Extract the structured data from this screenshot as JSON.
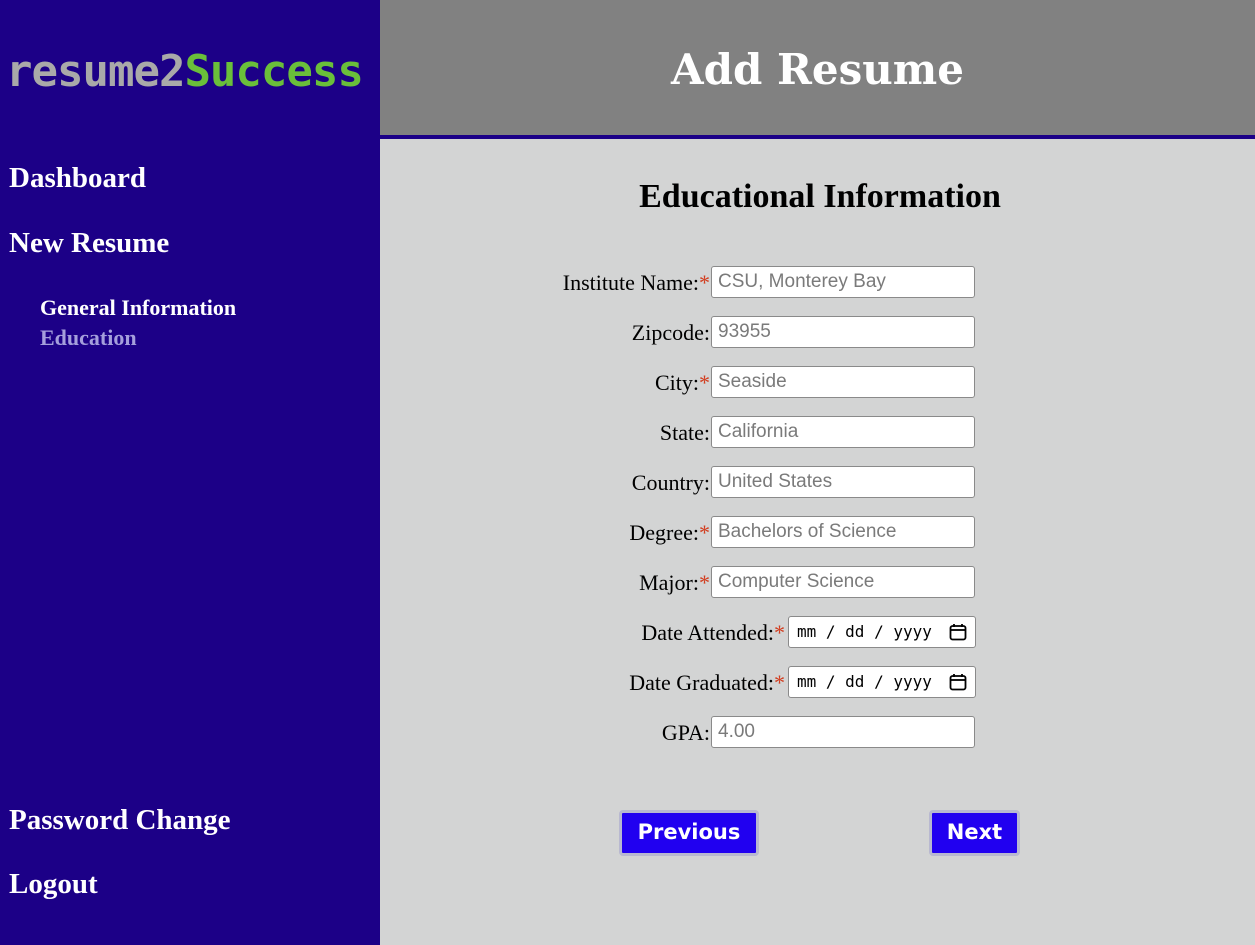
{
  "sidebar": {
    "logo_part1": "resume2",
    "logo_part2": "Success",
    "nav": {
      "dashboard": "Dashboard",
      "new_resume": "New Resume",
      "general_information": "General Information",
      "education": "Education",
      "password_change": "Password Change",
      "logout": "Logout"
    }
  },
  "header": {
    "title": "Add Resume"
  },
  "form": {
    "section_title": "Educational Information",
    "required_marker": "*",
    "fields": {
      "institute_name": {
        "label": "Institute Name:",
        "placeholder": "CSU, Monterey Bay"
      },
      "zipcode": {
        "label": "Zipcode:",
        "placeholder": "93955"
      },
      "city": {
        "label": "City:",
        "placeholder": "Seaside"
      },
      "state": {
        "label": "State:",
        "placeholder": "California"
      },
      "country": {
        "label": "Country:",
        "placeholder": "United States"
      },
      "degree": {
        "label": "Degree:",
        "placeholder": "Bachelors of Science"
      },
      "major": {
        "label": "Major:",
        "placeholder": "Computer Science"
      },
      "date_attended": {
        "label": "Date Attended:",
        "placeholder": "mm / dd / yyyy"
      },
      "date_graduated": {
        "label": "Date Graduated:",
        "placeholder": "mm / dd / yyyy"
      },
      "gpa": {
        "label": "GPA:",
        "placeholder": "4.00"
      }
    },
    "buttons": {
      "previous": "Previous",
      "next": "Next"
    }
  },
  "colors": {
    "sidebar_bg": "#1c0087",
    "header_bg": "#818181",
    "page_bg": "#d3d4d4",
    "logo_gray": "#a9a9a9",
    "logo_green": "#6abf3a",
    "active_nav": "#a59fdc",
    "button_bg": "#2100f0",
    "required": "#d23c1e"
  }
}
